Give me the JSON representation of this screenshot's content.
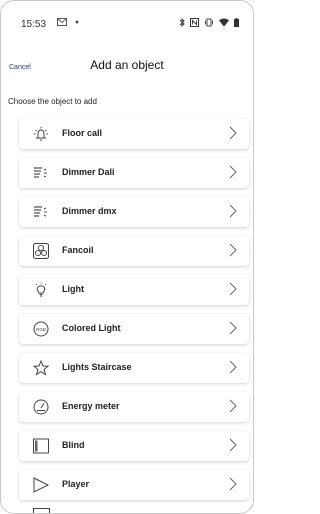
{
  "status": {
    "time": "15:53",
    "left_icons": [
      "gmail-icon",
      "dot-icon"
    ],
    "right_icons": [
      "bluetooth-icon",
      "nfc-icon",
      "vibrate-icon",
      "wifi-icon",
      "battery-icon"
    ]
  },
  "header": {
    "cancel_label": "Cancel",
    "title": "Add an object"
  },
  "subtitle": "Choose the object to add",
  "items": [
    {
      "label": "Floor call",
      "icon": "floor-call-icon"
    },
    {
      "label": "Dimmer Dali",
      "icon": "dimmer-icon"
    },
    {
      "label": "Dimmer dmx",
      "icon": "dimmer-icon"
    },
    {
      "label": "Fancoil",
      "icon": "fan-icon"
    },
    {
      "label": "Light",
      "icon": "light-bulb-icon"
    },
    {
      "label": "Colored Light",
      "icon": "rgb-icon",
      "icon_text": "RGB"
    },
    {
      "label": "Lights Staircase",
      "icon": "star-icon"
    },
    {
      "label": "Energy meter",
      "icon": "gauge-icon"
    },
    {
      "label": "Blind",
      "icon": "blind-icon"
    },
    {
      "label": "Player",
      "icon": "play-icon"
    }
  ]
}
